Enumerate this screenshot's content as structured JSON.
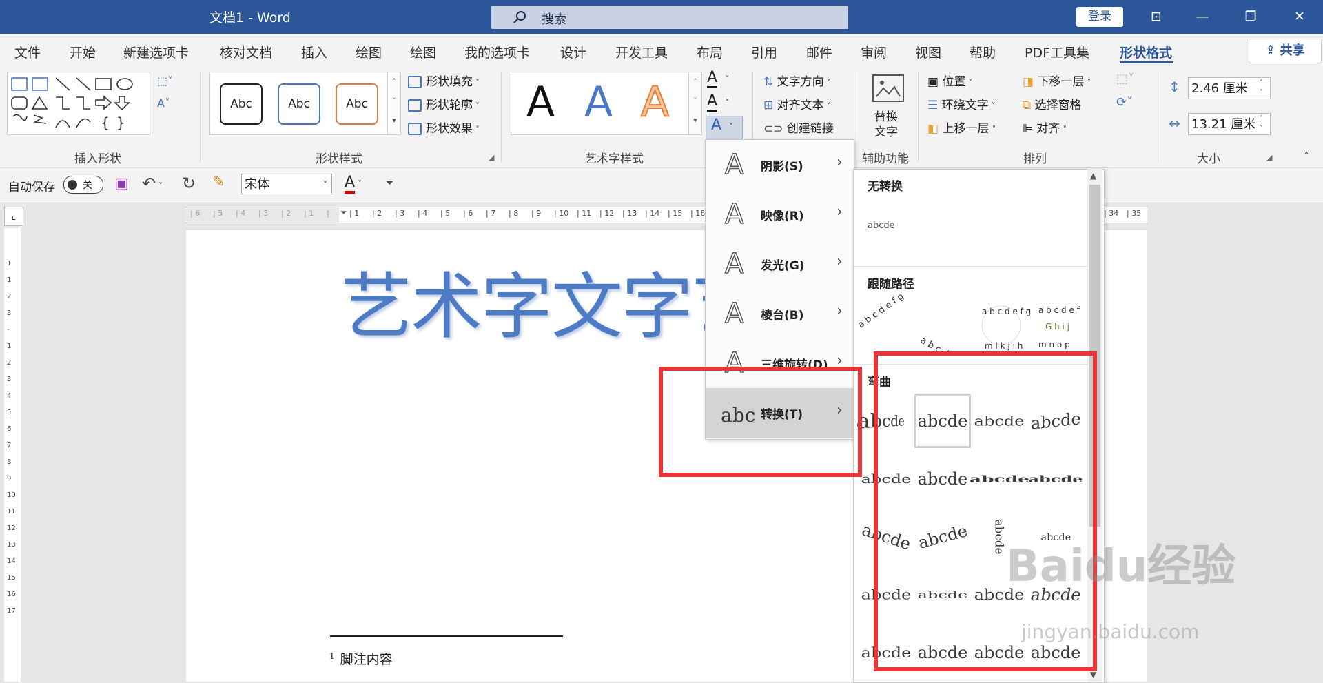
{
  "titlebar": {
    "doc_title": "文档1  -  Word",
    "search_label": "搜索",
    "login": "登录",
    "colors": {
      "bar": "#2b579a"
    }
  },
  "tabs": [
    "文件",
    "开始",
    "新建选项卡",
    "核对文档",
    "插入",
    "绘图",
    "绘图",
    "我的选项卡",
    "设计",
    "开发工具",
    "布局",
    "引用",
    "邮件",
    "审阅",
    "视图",
    "帮助",
    "PDF工具集"
  ],
  "active_tab": "形状格式",
  "share": "共享",
  "ribbon": {
    "shape_style_samples": [
      "Abc",
      "Abc",
      "Abc"
    ],
    "shape_fill": "形状填充",
    "shape_outline": "形状轮廓",
    "shape_effects": "形状效果",
    "text_direction": "文字方向",
    "align_text": "对齐文本",
    "create_link": "创建链接",
    "alt_text_line1": "替换",
    "alt_text_line2": "文字",
    "position": "位置",
    "wrap_text": "环绕文字",
    "bring_forward": "上移一层",
    "send_backward": "下移一层",
    "selection_pane": "选择窗格",
    "align": "对齐",
    "height": "2.46 厘米",
    "width": "13.21 厘米",
    "groups": {
      "insert_shapes": "插入形状",
      "shape_styles": "形状样式",
      "wordart_styles": "艺术字样式",
      "accessibility": "辅助功能",
      "arrange": "排列",
      "size": "大小"
    }
  },
  "qat": {
    "autosave": "自动保存",
    "toggle": "关",
    "font": "宋体"
  },
  "ruler_ticks": [
    "6",
    "5",
    "4",
    "3",
    "2",
    "1",
    "",
    "1",
    "2",
    "3",
    "4",
    "5",
    "6",
    "7",
    "8",
    "9",
    "10",
    "11",
    "12",
    "13",
    "14",
    "15",
    "16"
  ],
  "ruler_right": [
    "34",
    "35"
  ],
  "vruler_ticks": [
    "1",
    "1",
    "2",
    "3",
    "",
    "1",
    "2",
    "3",
    "4",
    "5",
    "6",
    "7",
    "8",
    "9",
    "10",
    "11",
    "12",
    "13",
    "14",
    "15",
    "16",
    "17"
  ],
  "document": {
    "wordart": "艺术字文字艺术",
    "footnote_num": "1",
    "footnote": "脚注内容"
  },
  "effects_menu": [
    {
      "label": "阴影(S)",
      "icon": "A"
    },
    {
      "label": "映像(R)",
      "icon": "A"
    },
    {
      "label": "发光(G)",
      "icon": "A"
    },
    {
      "label": "棱台(B)",
      "icon": "A"
    },
    {
      "label": "三维旋转(D)",
      "icon": "A"
    },
    {
      "label": "转换(T)",
      "icon": "abc"
    }
  ],
  "transform_panel": {
    "no_transform": "无转换",
    "no_transform_sample": "abcde",
    "follow_path": "跟随路径",
    "warp": "弯曲",
    "cells": [
      "abcde",
      "abcde",
      "abcde",
      "abcde",
      "abcde",
      "abcde",
      "abcde",
      "abcde",
      "abcde",
      "abcde",
      "abcde",
      "abcde",
      "abcde",
      "abcde",
      "abcde",
      "abcde",
      "abcde",
      "abcde",
      "abcde",
      "abcde"
    ]
  },
  "watermark": {
    "logo": "Baidu经验",
    "url": "jingyan.baidu.com"
  },
  "colors": {
    "highlight_box": "#e8373b",
    "accent": "#2b579a",
    "wordart": "#4d7cc5"
  }
}
